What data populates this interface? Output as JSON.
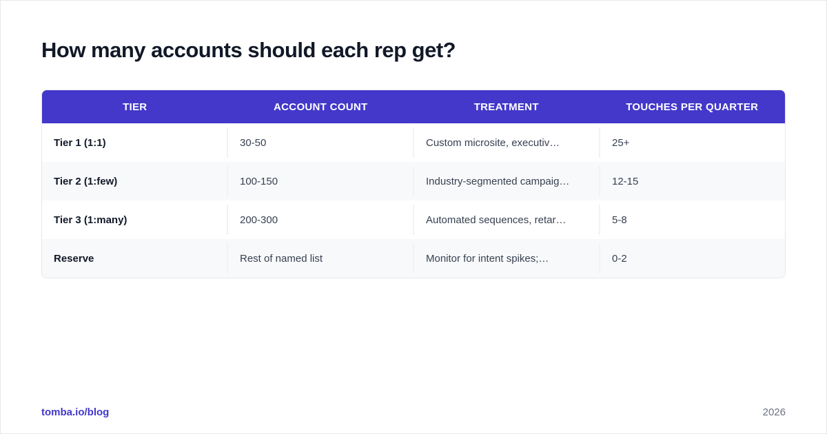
{
  "title": "How many accounts should each rep get?",
  "table": {
    "headers": [
      "TIER",
      "ACCOUNT COUNT",
      "TREATMENT",
      "TOUCHES PER QUARTER"
    ],
    "rows": [
      [
        "Tier 1 (1:1)",
        "30-50",
        "Custom microsite, executiv…",
        "25+"
      ],
      [
        "Tier 2 (1:few)",
        "100-150",
        "Industry-segmented campaig…",
        "12-15"
      ],
      [
        "Tier 3 (1:many)",
        "200-300",
        "Automated sequences, retar…",
        "5-8"
      ],
      [
        "Reserve",
        "Rest of named list",
        "Monitor for intent spikes;…",
        "0-2"
      ]
    ]
  },
  "footer": {
    "link": "tomba.io/blog",
    "year": "2026"
  },
  "colors": {
    "header_bg": "#4338ca",
    "title": "#111827",
    "link": "#4338ca"
  }
}
